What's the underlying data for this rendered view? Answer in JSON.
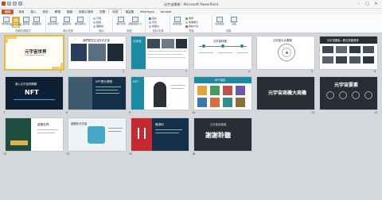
{
  "window": {
    "title": "元宇宙簡報 - Microsoft PowerPoint",
    "min": "–",
    "max": "□",
    "close": "✕"
  },
  "tabs": [
    "檔案",
    "常用",
    "插入",
    "設計",
    "轉場",
    "動畫",
    "投影片放映",
    "校閱",
    "檢視",
    "增益集",
    "Meshtype",
    "Acrobat"
  ],
  "ribbon": {
    "groups": [
      {
        "label": "簡報檢視模式",
        "buttons": [
          "標準模式",
          "投影片瀏覽",
          "備忘稿",
          "閱讀檢視"
        ]
      },
      {
        "label": "母片檢視",
        "buttons": [
          "投影片母片",
          "講義母片",
          "備忘稿母片"
        ]
      },
      {
        "label": "顯示",
        "items": [
          "尺規",
          "格線",
          "輔助線"
        ]
      },
      {
        "label": "縮放",
        "buttons": [
          "顯示比例",
          "調整視窗大小"
        ]
      },
      {
        "label": "色彩/灰階",
        "items": [
          "色彩",
          "灰階",
          "純黑白"
        ]
      },
      {
        "label": "視窗",
        "buttons": [
          "開新視窗"
        ],
        "items": [
          "重排",
          "重疊顯示",
          "移動分割"
        ]
      },
      {
        "label": "巨集",
        "buttons": [
          "切換視窗",
          "巨集"
        ]
      }
    ]
  },
  "slides": [
    {
      "n": "1",
      "title": "元宇宙世界"
    },
    {
      "n": "2",
      "title": "我們是否生活在元宇宙"
    },
    {
      "n": "3",
      "title": "元宇宙"
    },
    {
      "n": "4",
      "title": "元宇宙特徵"
    },
    {
      "n": "5",
      "title": "元宇宙七大要素"
    },
    {
      "n": "6",
      "title": "元宇宙要素—數位資產經濟"
    },
    {
      "n": "7",
      "title": "NFT",
      "sub": "進入元宇宙的關鍵"
    },
    {
      "n": "8",
      "title": "NFT是什麼呢"
    },
    {
      "n": "9",
      "title": "NFT"
    },
    {
      "n": "10",
      "title": "NFT項目"
    },
    {
      "n": "11",
      "title": "元宇宙商機大商機"
    },
    {
      "n": "12",
      "title": "元宇宙要素"
    },
    {
      "n": "13",
      "title": "虛擬世界"
    },
    {
      "n": "14",
      "title": "遊戲化元宇宙"
    },
    {
      "n": "15",
      "title": "雅達利"
    },
    {
      "n": "16",
      "title": "謝謝聆聽",
      "sub": "元宇宙這條路"
    }
  ]
}
